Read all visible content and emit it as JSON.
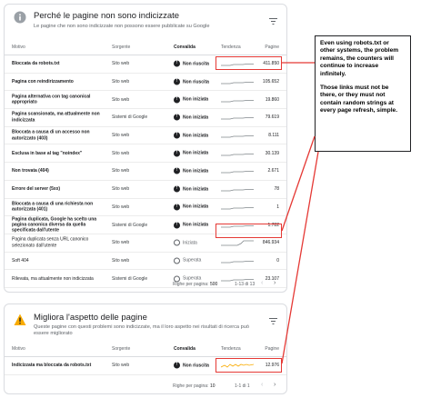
{
  "card1": {
    "title": "Perché le pagine non sono indicizzate",
    "subtitle": "Le pagine che non sono indicizzate non possono essere pubblicate su Google",
    "headers": {
      "reason": "Motivo",
      "source": "Sorgente",
      "validation": "Convalida",
      "trend": "Tendenza",
      "pages": "Pagine"
    },
    "rows": [
      {
        "reason": "Bloccata da robots.txt",
        "source": "Sito web",
        "status": "fail",
        "validation": "Non riuscita",
        "pages": "411.850"
      },
      {
        "reason": "Pagina con reindirizzamento",
        "source": "Sito web",
        "status": "fail",
        "validation": "Non riuscita",
        "pages": "105.652"
      },
      {
        "reason": "Pagina alternativa con tag canonical appropriato",
        "source": "Sito web",
        "status": "fail",
        "validation": "Non iniziata",
        "pages": "19.860"
      },
      {
        "reason": "Pagina scansionata, ma attualmente non indicizzata",
        "source": "Sistemi di Google",
        "status": "fail",
        "validation": "Non iniziata",
        "pages": "79.619"
      },
      {
        "reason": "Bloccata a causa di un accesso non autorizzato (403)",
        "source": "Sito web",
        "status": "fail",
        "validation": "Non iniziata",
        "pages": "8.111"
      },
      {
        "reason": "Esclusa in base al tag \"noindex\"",
        "source": "Sito web",
        "status": "fail",
        "validation": "Non iniziata",
        "pages": "30.139"
      },
      {
        "reason": "Non trovata (404)",
        "source": "Sito web",
        "status": "fail",
        "validation": "Non iniziata",
        "pages": "2.671"
      },
      {
        "reason": "Errore del server (5xx)",
        "source": "Sito web",
        "status": "fail",
        "validation": "Non iniziata",
        "pages": "78"
      },
      {
        "reason": "Bloccata a causa di una richiesta non autorizzata (401)",
        "source": "Sito web",
        "status": "fail",
        "validation": "Non iniziata",
        "pages": "1"
      },
      {
        "reason": "Pagina duplicata, Google ha scelto una pagina canonica diversa da quella specificata dall'utente",
        "source": "Sistemi di Google",
        "status": "fail",
        "validation": "Non iniziata",
        "pages": "1.782"
      },
      {
        "reason": "Pagina duplicata senza URL canonico selezionato dall'utente",
        "source": "Sito web",
        "status": "start",
        "validation": "Iniziata",
        "pages": "846.934"
      },
      {
        "reason": "Soft 404",
        "source": "Sito web",
        "status": "pass",
        "validation": "Superata",
        "pages": "0"
      },
      {
        "reason": "Rilevata, ma attualmente non indicizzata",
        "source": "Sistemi di Google",
        "status": "pass",
        "validation": "Superata",
        "pages": "23.107"
      }
    ],
    "pager": {
      "rows_per_page_label": "Righe per pagina:",
      "rows_per_page": "500",
      "range": "1-13 di 13"
    }
  },
  "card2": {
    "title": "Migliora l'aspetto delle pagine",
    "subtitle": "Queste pagine con questi problemi sono indicizzate, ma il loro aspetto nei risultati di ricerca può essere migliorato",
    "headers": {
      "reason": "Motivo",
      "source": "Sorgente",
      "validation": "Convalida",
      "trend": "Tendenza",
      "pages": "Pagine"
    },
    "rows": [
      {
        "reason": "Indicizzata ma bloccata da robots.txt",
        "source": "Sito web",
        "status": "fail",
        "validation": "Non riuscita",
        "pages": "12.976"
      }
    ],
    "pager": {
      "rows_per_page_label": "Righe per pagina:",
      "rows_per_page": "10",
      "range": "1-1 di 1"
    }
  },
  "annotation": {
    "paragraph1": "Even using robots.txt or other systems, the problem remains, the counters will continue to increase infinitely.",
    "paragraph2": "Those links must not be there, or they must not contain random strings at every page refresh, simple."
  },
  "colors": {
    "highlight": "#e53935",
    "warning": "#f9ab00",
    "sparkline": "#80868b",
    "sparkline_warn": "#f9ab00"
  },
  "icons": {
    "card1": "info-icon",
    "card2": "warning-icon",
    "filter": "filter-icon",
    "prev": "chevron-left-icon",
    "next": "chevron-right-icon"
  }
}
